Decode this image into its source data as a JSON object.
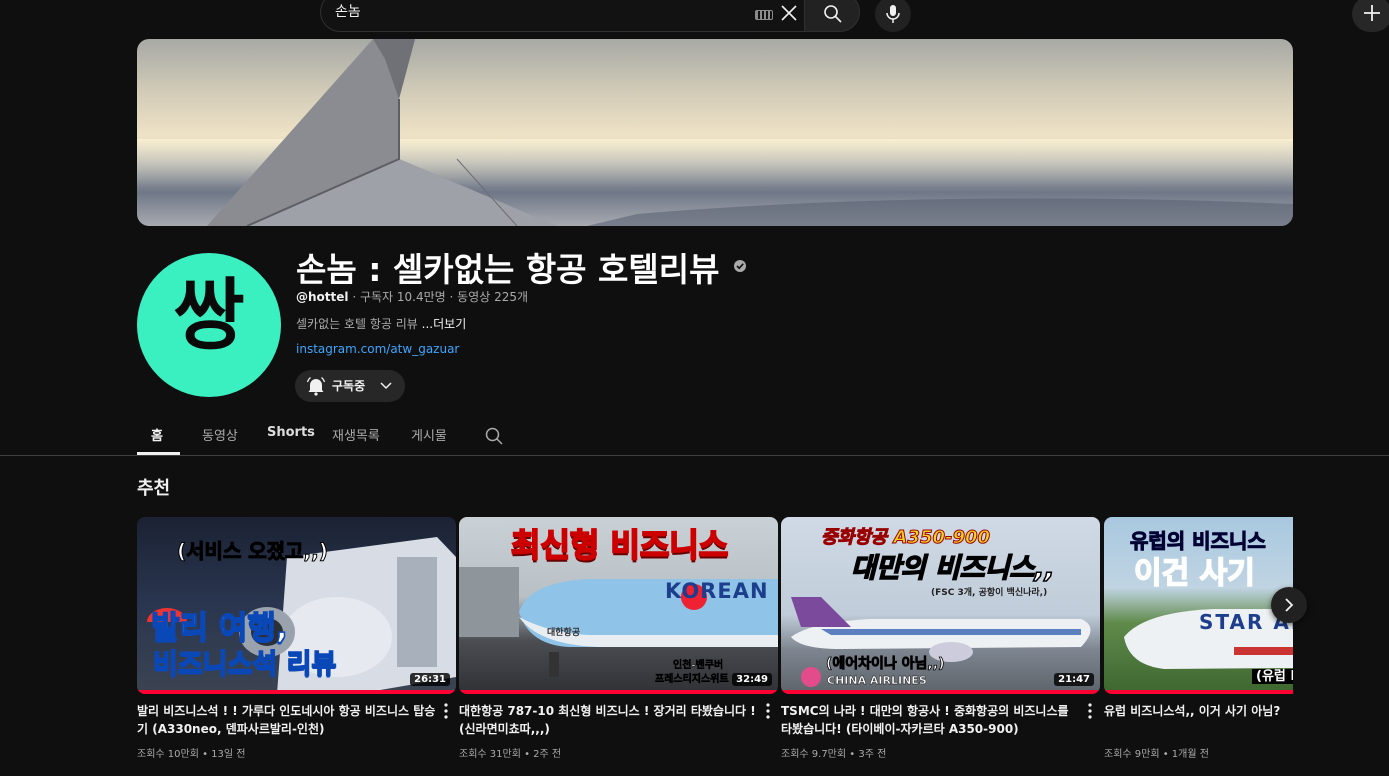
{
  "search": {
    "value": "손놈",
    "placeholder": "검색"
  },
  "channel": {
    "name": "손놈 : 셀카없는 항공 호텔리뷰",
    "avatar_glyph": "쌍",
    "handle": "@hottel",
    "stats": " · 구독자 10.4만명 · 동영상 225개",
    "description": "셀카없는 호텔 항공 리뷰 ",
    "more": "...더보기",
    "link": "instagram.com/atw_gazuar",
    "subscribed_label": "구독중",
    "avatar_color": "#3bf0c0"
  },
  "tabs": [
    "홈",
    "동영상",
    "Shorts",
    "재생목록",
    "게시물"
  ],
  "section_title": "추천",
  "videos": [
    {
      "title": "발리 비즈니스석 ! ! 가루다 인도네시아 항공 비즈니스 탑승기 (A330neo, 덴파사르발리-인천)",
      "meta": "조회수 10만회 • 13일 전",
      "duration": "26:31",
      "thumb_lines": [
        "(서비스 오졌고,,)",
        "발리 여행,",
        "비즈니스석 리뷰"
      ]
    },
    {
      "title": "대한항공 787-10 최신형 비즈니스 ! 장거리 타봤습니다 ! (신라면미쵸따,,,)",
      "meta": "조회수 31만회 • 2주 전",
      "duration": "32:49",
      "thumb_lines": [
        "최신형 비즈니스",
        "KOREAN",
        "대한항공",
        "인천-밴쿠버",
        "프레스티지스위트"
      ]
    },
    {
      "title": "TSMC의 나라 ! 대만의 항공사 ! 중화항공의 비즈니스를 타봤습니다! (타이베이-자카르타 A350-900)",
      "meta": "조회수 9.7만회 • 3주 전",
      "duration": "21:47",
      "thumb_lines": [
        "중화항공 A350-900",
        "대만의 비즈니스,,",
        "(FSC 3개, 공항이 백신나라,)",
        "(에어차이나 아님,,)",
        "CHINA AIRLINES"
      ]
    },
    {
      "title": "유럽 비즈니스석,, 이거 사기 아님?",
      "meta": "조회수 9만회 • 1개월 전",
      "duration": "",
      "thumb_lines": [
        "유럽의 비즈니스",
        "이건 사기",
        "STAR AL",
        "(유럽 L"
      ]
    }
  ]
}
